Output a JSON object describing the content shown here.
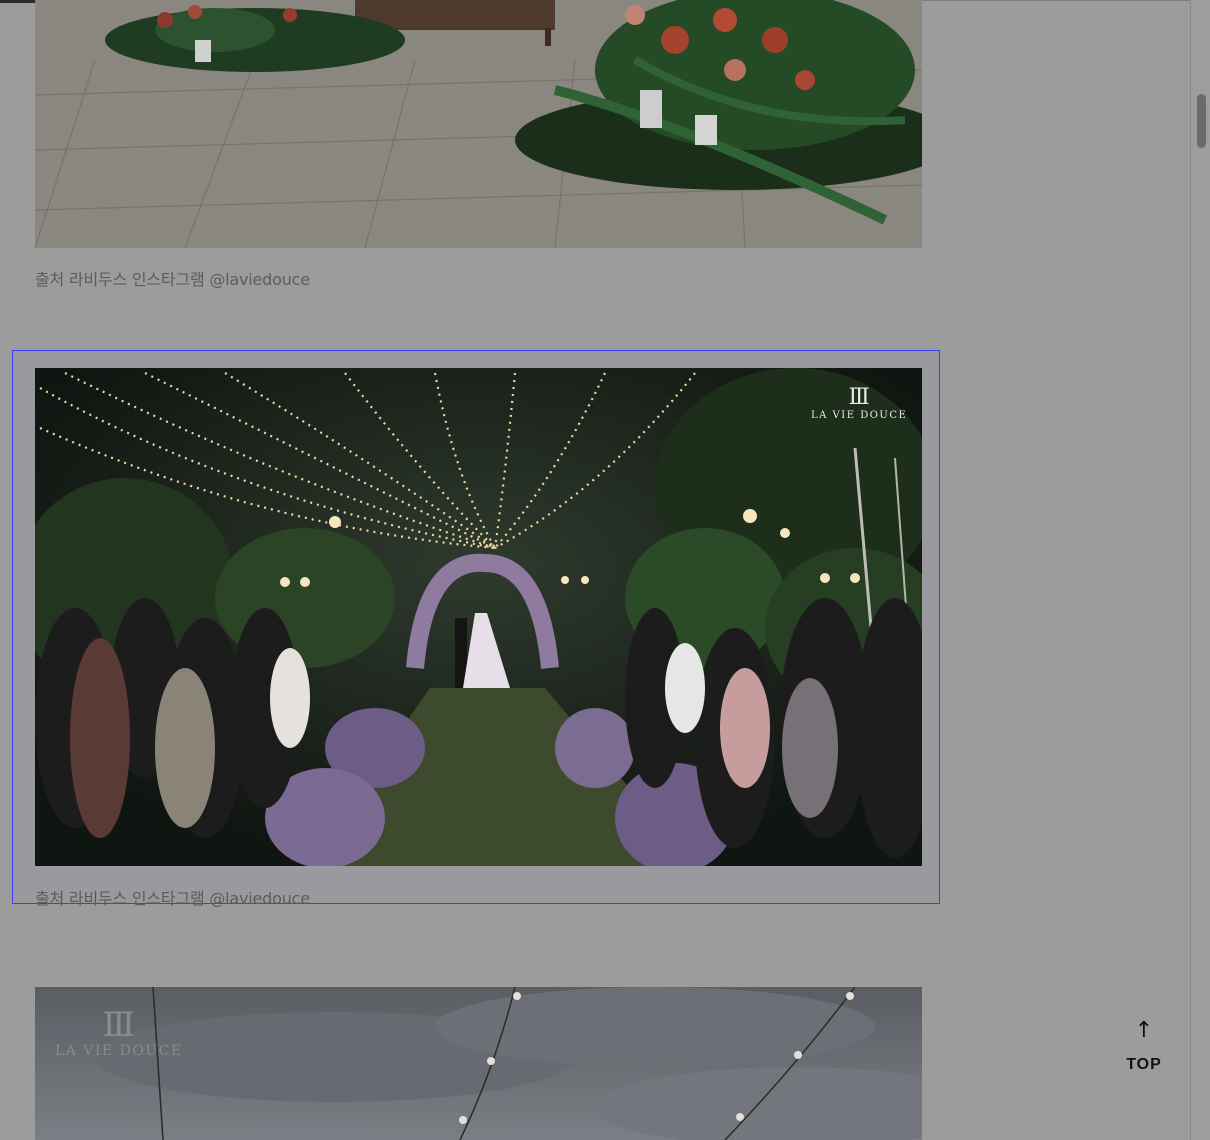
{
  "captions": {
    "first": "출처 라비두스 인스타그램 @laviedouce",
    "second": "출처 라비두스 인스타그램 @laviedouce"
  },
  "images": {
    "first": {
      "alt": "",
      "icon": "floral-arrangement-image"
    },
    "second": {
      "alt": "",
      "icon": "night-garden-wedding-image"
    },
    "third": {
      "alt": "",
      "icon": "cloudy-sky-string-lights-image"
    }
  },
  "watermarks": {
    "second": "LA VIE DOUCE",
    "third": "LA VIE DOUCE"
  },
  "top_button": {
    "arrow": "↑",
    "label": "TOP"
  },
  "colors": {
    "overlay": "#9c9c9c",
    "selection": "#3d3dff",
    "caption": "#5c5c5c"
  }
}
